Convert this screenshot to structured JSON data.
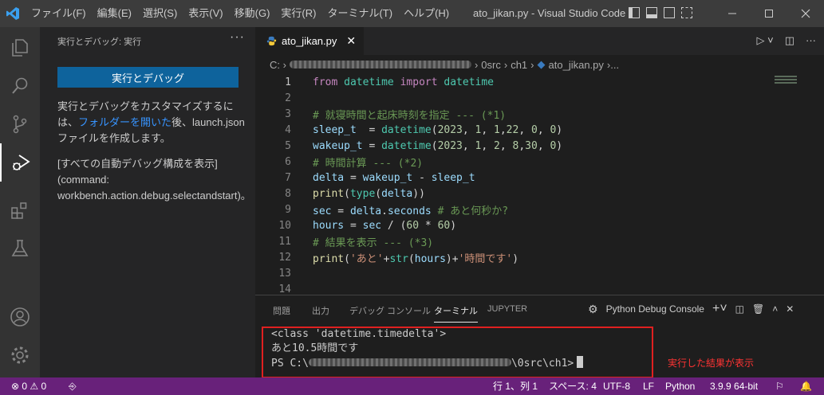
{
  "titlebar": {
    "menu": [
      "ファイル(F)",
      "編集(E)",
      "選択(S)",
      "表示(V)",
      "移動(G)",
      "実行(R)",
      "ターミナル(T)",
      "ヘルプ(H)"
    ],
    "title": "ato_jikan.py - Visual Studio Code"
  },
  "sidebar": {
    "title": "実行とデバッグ: 実行",
    "more": "···",
    "run_button": "実行とデバッグ",
    "desc_before": "実行とデバッグをカスタマイズするには、",
    "desc_link": "フォルダーを開いた",
    "desc_after": "後、launch.json ファイルを作成します。",
    "show_all_1": "[すべての自動デバッグ構成を表示]",
    "show_all_2": "(command:",
    "show_all_3": "workbench.action.debug.selectandstart)。"
  },
  "editor": {
    "tab_label": "ato_jikan.py",
    "breadcrumb": {
      "drive": "C: ›",
      "folder1": "0src",
      "folder2": "ch1",
      "file": "ato_jikan.py",
      "tail": "›..."
    },
    "line_numbers": [
      "1",
      "2",
      "3",
      "4",
      "5",
      "6",
      "7",
      "8",
      "9",
      "10",
      "11",
      "12",
      "13",
      "14"
    ],
    "current_line": 1
  },
  "panel": {
    "tabs": [
      "問題",
      "出力",
      "デバッグ コンソール",
      "ターミナル",
      "JUPYTER"
    ],
    "active_tab": "ターミナル",
    "console_label": "Python Debug Console",
    "terminal_lines": {
      "l1": "<class 'datetime.timedelta'>",
      "l2": "あと10.5時間です",
      "l3_prefix": "PS C:\\",
      "l3_suffix": "\\0src\\ch1>"
    },
    "annotation": "実行した結果が表示"
  },
  "statusbar": {
    "errors": "⊗ 0 ⚠ 0",
    "position": "行 1、列 1",
    "spaces": "スペース: 4",
    "encoding": "UTF-8",
    "eol": "LF",
    "language": "Python",
    "interpreter": "3.9.9 64-bit"
  },
  "colors": {
    "statusbar": "#68217a",
    "run_button": "#0e639c",
    "annotation": "#e02020"
  }
}
